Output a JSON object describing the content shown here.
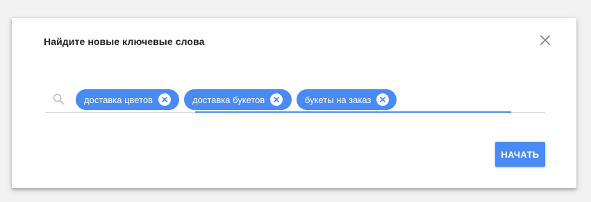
{
  "dialog": {
    "title": "Найдите новые ключевые слова",
    "close_icon": "close-icon"
  },
  "search": {
    "icon": "search-icon",
    "chips": [
      {
        "label": "доставка цветов",
        "remove_icon": "close-circle-icon"
      },
      {
        "label": "доставка букетов",
        "remove_icon": "close-circle-icon"
      },
      {
        "label": "букеты на заказ",
        "remove_icon": "close-circle-icon"
      }
    ],
    "input_value": ""
  },
  "actions": {
    "start_label": "НАЧАТЬ"
  },
  "colors": {
    "accent": "#4a8af4",
    "background": "#f1f1f1",
    "dialog": "#ffffff",
    "title_text": "#202124",
    "icon_gray": "#9aa0a6"
  }
}
